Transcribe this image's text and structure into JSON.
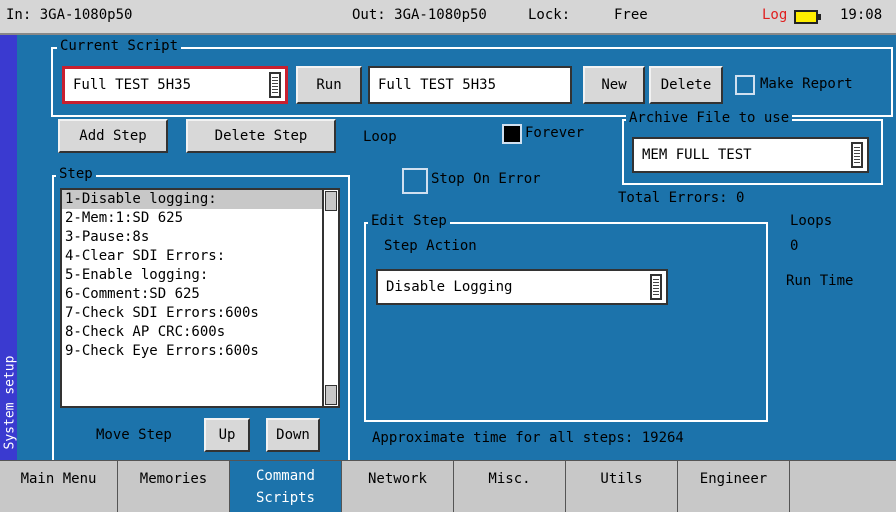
{
  "status": {
    "in": "In: 3GA-1080p50",
    "out": "Out: 3GA-1080p50",
    "lock_label": "Lock:",
    "lock_value": "Free",
    "log": "Log",
    "time": "19:08"
  },
  "sidebar": {
    "label": "System setup"
  },
  "current_script": {
    "legend": "Current Script",
    "selected": "Full TEST 5H35",
    "run_label": "Run",
    "name_value": "Full TEST 5H35",
    "new_label": "New",
    "delete_label": "Delete",
    "make_report_label": "Make Report"
  },
  "step_buttons": {
    "add": "Add Step",
    "delete": "Delete Step"
  },
  "loop": {
    "label": "Loop",
    "forever_label": "Forever",
    "forever_checked": true
  },
  "archive": {
    "legend": "Archive File to use",
    "value": "MEM FULL TEST"
  },
  "step": {
    "legend": "Step",
    "items": [
      "1-Disable logging:",
      "2-Mem:1:SD 625",
      "3-Pause:8s",
      "4-Clear SDI Errors:",
      "5-Enable logging:",
      "6-Comment:SD 625",
      "7-Check SDI Errors:600s",
      "8-Check AP CRC:600s",
      "9-Check Eye Errors:600s"
    ],
    "move_label": "Move Step",
    "up_label": "Up",
    "down_label": "Down"
  },
  "stop_on_error": {
    "label": "Stop On Error",
    "checked": false
  },
  "total_errors": "Total Errors: 0",
  "loops": {
    "label": "Loops",
    "value": "0"
  },
  "run_time": {
    "label": "Run Time"
  },
  "edit_step": {
    "legend": "Edit Step",
    "action_label": "Step Action",
    "action_value": "Disable Logging"
  },
  "approx": "Approximate time for all steps: 19264",
  "tabs": [
    {
      "label": "Main Menu",
      "active": false
    },
    {
      "label": "Memories",
      "active": false
    },
    {
      "label": "Command\nScripts",
      "active": true
    },
    {
      "label": "Network",
      "active": false
    },
    {
      "label": "Misc.",
      "active": false
    },
    {
      "label": "Utils",
      "active": false
    },
    {
      "label": "Engineer",
      "active": false
    }
  ],
  "colors": {
    "background": "#1c73ab",
    "sidebar": "#3a3ad0",
    "log": "#e02020",
    "battery": "#ffee00",
    "selected_border": "#c82030"
  }
}
